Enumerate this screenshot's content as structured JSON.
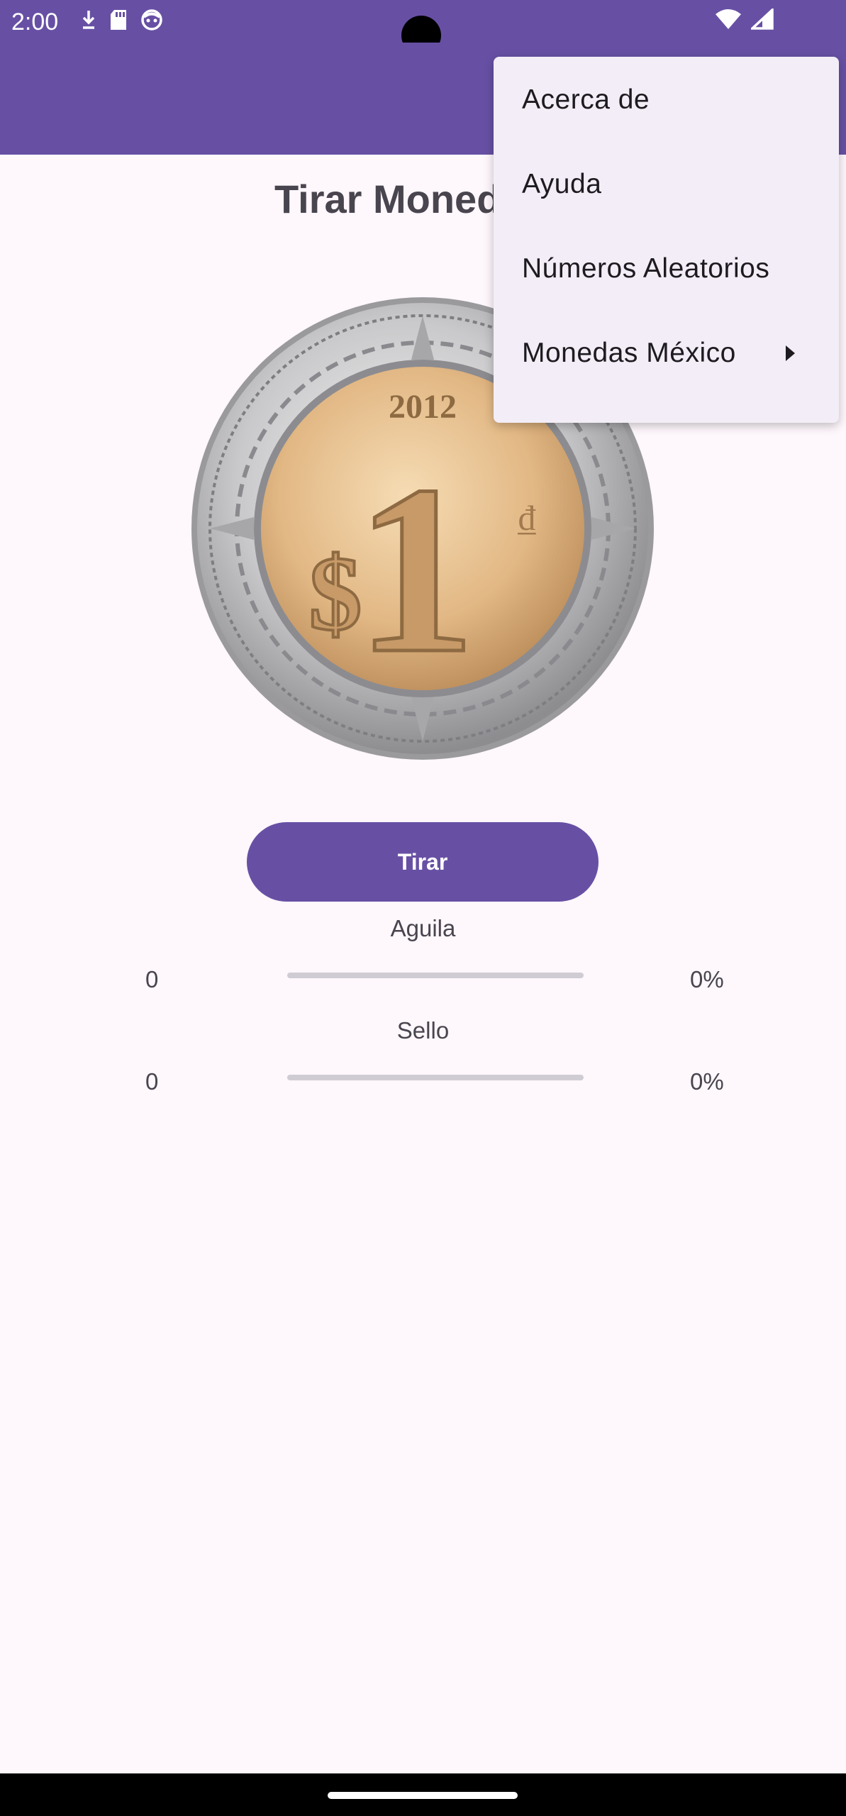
{
  "status_bar": {
    "time": "2:00",
    "icons": [
      "download-icon",
      "sd-card-icon",
      "face-icon",
      "wifi-icon",
      "signal-icon"
    ]
  },
  "page": {
    "title": "Tirar Moneda Si"
  },
  "coin": {
    "year": "2012",
    "denomination": "1",
    "currency_symbol": "$"
  },
  "actions": {
    "tirar_label": "Tirar"
  },
  "stats": {
    "aguila": {
      "label": "Aguila",
      "count": "0",
      "percent": "0%",
      "progress": 0
    },
    "sello": {
      "label": "Sello",
      "count": "0",
      "percent": "0%",
      "progress": 0
    }
  },
  "menu": {
    "items": [
      {
        "label": "Acerca de"
      },
      {
        "label": "Ayuda"
      },
      {
        "label": "Números Aleatorios"
      },
      {
        "label": "Monedas México",
        "has_submenu": true
      }
    ]
  },
  "colors": {
    "primary": "#6750a4",
    "background": "#fef7fc",
    "menu_surface": "#f3edf7"
  }
}
